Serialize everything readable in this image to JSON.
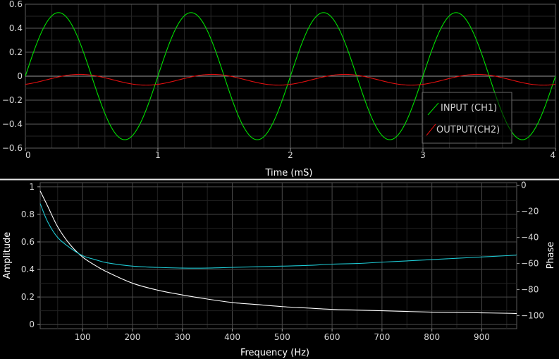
{
  "chart_data": [
    {
      "type": "line",
      "xlabel": "Time (mS)",
      "ylabel": "",
      "xlim": [
        0,
        4
      ],
      "ylim": [
        -0.6,
        0.6
      ],
      "xticks": [
        0,
        1,
        2,
        3,
        4
      ],
      "xtick_labels": [
        "0",
        "1",
        "2",
        "3",
        "4"
      ],
      "yticks": [
        0.6,
        0.4,
        0.2,
        0,
        -0.2,
        -0.4,
        -0.6
      ],
      "ytick_labels": [
        "0.6",
        "0.4",
        "0.2",
        "0",
        "−0.2",
        "−0.4",
        "−0.6"
      ],
      "grid": true,
      "legend": "right",
      "series": [
        {
          "name": "INPUT (CH1)",
          "color": "#00e000",
          "amplitude": 0.53,
          "frequency_khz": 1.0,
          "phase_deg": 0
        },
        {
          "name": "OUTPUT(CH2)",
          "color": "#e01010",
          "amplitude": 0.045,
          "offset": -0.03,
          "frequency_khz": 1.0,
          "phase_deg": -58
        }
      ]
    },
    {
      "type": "line",
      "xlabel": "Frequency (Hz)",
      "ylabel": "Amplitude",
      "y2label": "Phase",
      "xlim": [
        15,
        970
      ],
      "ylim": [
        -0.03,
        1.03
      ],
      "y2lim": [
        -110,
        2
      ],
      "xticks": [
        100,
        200,
        300,
        400,
        500,
        600,
        700,
        800,
        900
      ],
      "xtick_labels": [
        "100",
        "200",
        "300",
        "400",
        "500",
        "600",
        "700",
        "800",
        "900"
      ],
      "yticks": [
        1,
        0.8,
        0.6,
        0.4,
        0.2,
        0
      ],
      "ytick_labels": [
        "1",
        "0.8",
        "0.6",
        "0.4",
        "0.2",
        "0"
      ],
      "y2ticks": [
        0,
        -20,
        -40,
        -60,
        -80,
        -100
      ],
      "y2tick_labels": [
        "0",
        "−20",
        "−40",
        "−60",
        "−80",
        "−100"
      ],
      "grid": true,
      "series": [
        {
          "name": "Amplitude",
          "axis": "left",
          "color": "#ffffff",
          "x": [
            15,
            30,
            50,
            75,
            100,
            125,
            150,
            200,
            250,
            300,
            350,
            400,
            450,
            500,
            550,
            600,
            650,
            700,
            750,
            800,
            850,
            900,
            950,
            970
          ],
          "y": [
            0.97,
            0.86,
            0.71,
            0.58,
            0.49,
            0.43,
            0.38,
            0.3,
            0.25,
            0.215,
            0.185,
            0.16,
            0.145,
            0.13,
            0.12,
            0.11,
            0.105,
            0.1,
            0.095,
            0.09,
            0.088,
            0.085,
            0.082,
            0.08
          ]
        },
        {
          "name": "Phase",
          "axis": "right",
          "color": "#1ec8d2",
          "x": [
            15,
            30,
            50,
            75,
            100,
            125,
            150,
            200,
            250,
            300,
            350,
            400,
            450,
            500,
            550,
            600,
            650,
            700,
            750,
            800,
            850,
            900,
            950,
            970
          ],
          "y": [
            -14,
            -28,
            -40,
            -48,
            -54,
            -57,
            -59.5,
            -62,
            -63,
            -63.5,
            -63.5,
            -63,
            -62.5,
            -62,
            -61.5,
            -60.5,
            -60,
            -59,
            -58,
            -57,
            -56,
            -55,
            -54,
            -53.5
          ]
        }
      ]
    }
  ]
}
